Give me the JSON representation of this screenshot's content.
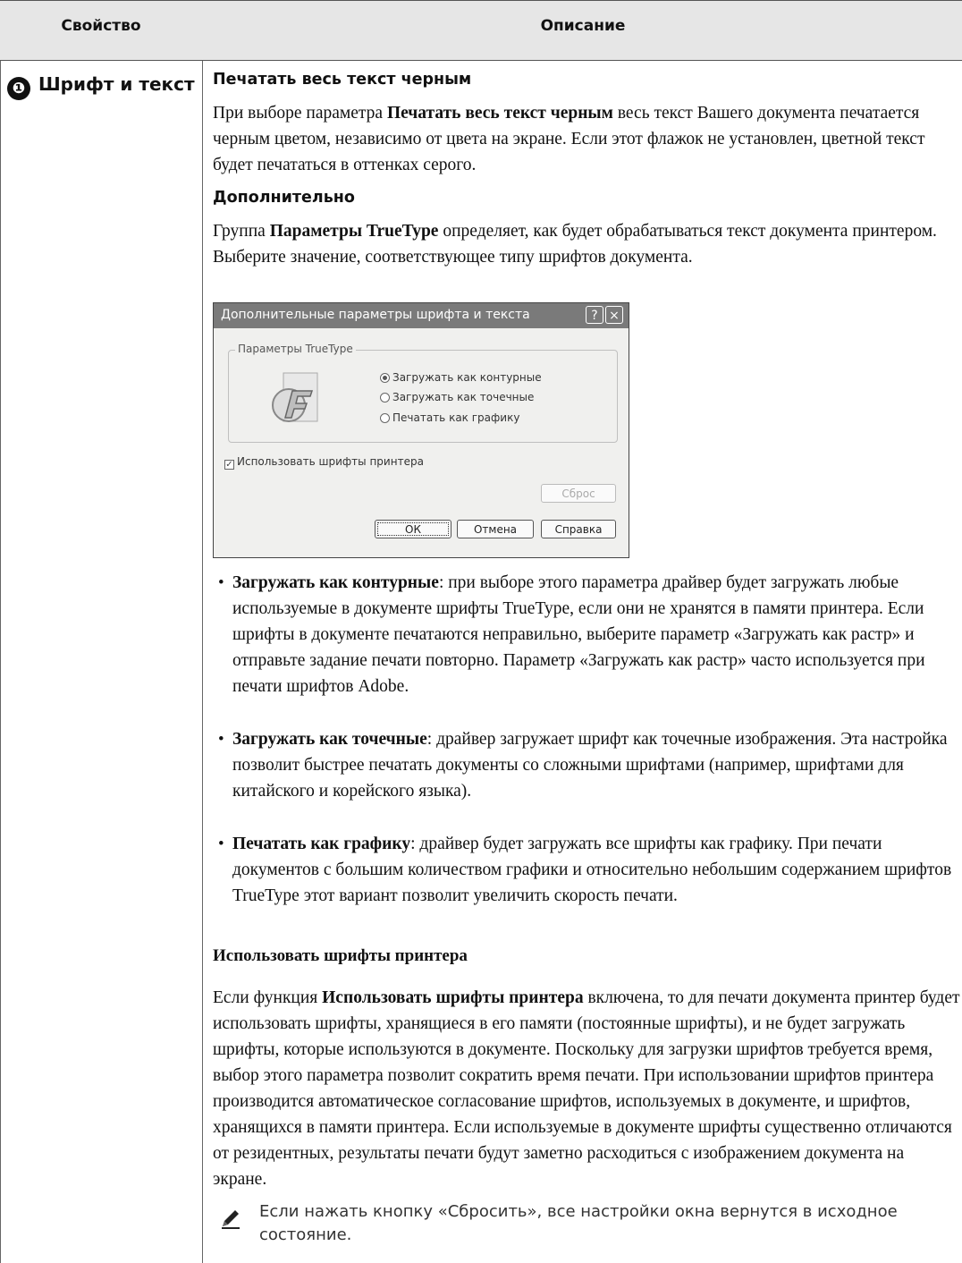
{
  "table": {
    "col_property": "Свойство",
    "col_description": "Описание"
  },
  "property": {
    "number": "❶",
    "title": "Шрифт и текст"
  },
  "section1": {
    "heading": "Печатать весь текст черным",
    "para_intro": "При выборе параметра ",
    "para_bold": "Печатать весь текст черным",
    "para_rest": " весь текст Вашего документа печатается черным цветом, независимо от цвета на экране. Если этот флажок не установлен, цветной текст будет печататься в оттенках серого."
  },
  "section2": {
    "heading": "Дополнительно",
    "para_intro": "Группа ",
    "para_bold": "Параметры TrueType",
    "para_rest": " определяет, как будет обрабатываться текст документа принтером. Выберите значение, соответствующее типу шрифтов документа."
  },
  "dialog": {
    "title": "Дополнительные параметры шрифта и текста",
    "help_btn": "?",
    "close_btn": "×",
    "group_label": "Параметры TrueType",
    "radios": [
      "Загружать как контурные",
      "Загружать как точечные",
      "Печатать как графику"
    ],
    "selected_radio": 0,
    "checkbox_label": "Использовать шрифты принтера",
    "checkbox_checked": true,
    "reset_btn": "Сброс",
    "ok_btn": "ОК",
    "cancel_btn": "Отмена",
    "help_label_btn": "Справка"
  },
  "bullets": [
    {
      "bold": "Загружать как контурные",
      "text": ": при выборе этого параметра драйвер будет загружать любые используемые в документе шрифты TrueType, если они не хранятся в памяти принтера. Если шрифты в документе печатаются неправильно, выберите параметр «Загружать как растр» и отправьте задание печати повторно. Параметр «Загружать как растр» часто используется при печати шрифтов Adobe."
    },
    {
      "bold": "Загружать как точечные",
      "text": ": драйвер загружает шрифт как точечные изображения. Эта настройка позволит быстрее печатать документы со сложными шрифтами (например, шрифтами для китайского и корейского языка)."
    },
    {
      "bold": "Печатать как графику",
      "text": ": драйвер будет загружать все шрифты как графику. При печати документов с большим количеством графики и относительно небольшим содержанием шрифтов TrueType этот вариант позволит увеличить скорость печати."
    }
  ],
  "section3": {
    "heading": "Использовать шрифты принтера",
    "para_intro": "Если функция ",
    "para_bold": "Использовать шрифты принтера",
    "para_rest": " включена, то для печати документа принтер будет использовать шрифты, хранящиеся в его памяти (постоянные шрифты), и не будет загружать шрифты, которые используются в документе. Поскольку для загрузки шрифтов требуется время, выбор этого параметра позволит сократить время печати. При использовании шрифтов принтера производится автоматическое согласование шрифтов, используемых в документе, и шрифтов, хранящихся в памяти принтера. Если используемые в документе шрифты существенно отличаются от резидентных, результаты печати будут заметно расходиться с изображением документа на экране."
  },
  "note": {
    "icon": "pencil-note-icon",
    "text": "Если нажать кнопку «Сбросить», все настройки окна вернутся в исходное состояние."
  }
}
